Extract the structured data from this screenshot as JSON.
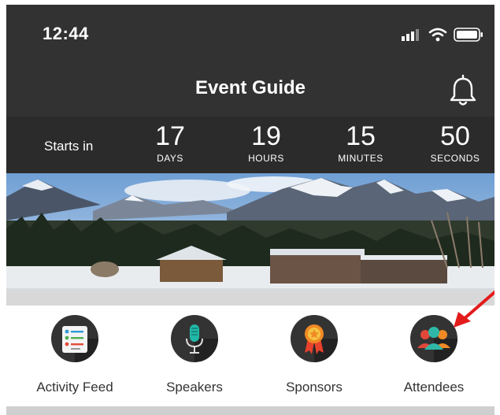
{
  "status_bar": {
    "time": "12:44"
  },
  "header": {
    "title": "Event Guide"
  },
  "countdown": {
    "label": "Starts in",
    "units": [
      {
        "value": "17",
        "label": "DAYS"
      },
      {
        "value": "19",
        "label": "HOURS"
      },
      {
        "value": "15",
        "label": "MINUTES"
      },
      {
        "value": "50",
        "label": "SECONDS"
      }
    ]
  },
  "shortcuts": [
    {
      "label": "Activity Feed",
      "icon": "activity-feed-icon"
    },
    {
      "label": "Speakers",
      "icon": "microphone-icon"
    },
    {
      "label": "Sponsors",
      "icon": "award-ribbon-icon"
    },
    {
      "label": "Attendees",
      "icon": "people-icon"
    }
  ],
  "colors": {
    "header": "#323232",
    "countdown": "#2b2b2b",
    "arrow": "#e31b1b"
  }
}
